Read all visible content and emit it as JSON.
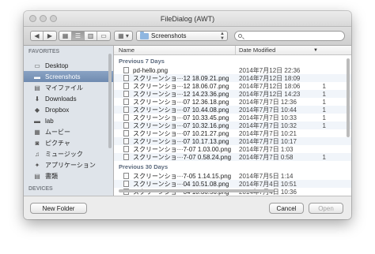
{
  "window": {
    "title": "FileDialog (AWT)"
  },
  "toolbar": {
    "back": "◀",
    "forward": "▶",
    "view_icon": "▦",
    "view_list": "☰",
    "view_columns": "▥",
    "view_coverflow": "▭",
    "arrange": "▦ ▾",
    "path_label": "Screenshots",
    "search_placeholder": ""
  },
  "sidebar": {
    "section_favorites": "FAVORITES",
    "section_devices": "DEVICES",
    "items": [
      {
        "label": "Desktop",
        "icon": "desktop-icon",
        "glyph": "▭"
      },
      {
        "label": "Screenshots",
        "icon": "folder-icon",
        "glyph": "▬"
      },
      {
        "label": "マイファイル",
        "icon": "all-my-files-icon",
        "glyph": "▤"
      },
      {
        "label": "Downloads",
        "icon": "downloads-icon",
        "glyph": "⬇"
      },
      {
        "label": "Dropbox",
        "icon": "dropbox-icon",
        "glyph": "◆"
      },
      {
        "label": "lab",
        "icon": "folder-icon",
        "glyph": "▬"
      },
      {
        "label": "ムービー",
        "icon": "movies-icon",
        "glyph": "▦"
      },
      {
        "label": "ピクチャ",
        "icon": "pictures-icon",
        "glyph": "◙"
      },
      {
        "label": "ミュージック",
        "icon": "music-icon",
        "glyph": "♫"
      },
      {
        "label": "アプリケーション",
        "icon": "applications-icon",
        "glyph": "✦"
      },
      {
        "label": "書類",
        "icon": "documents-icon",
        "glyph": "▤"
      }
    ]
  },
  "list": {
    "col_name": "Name",
    "col_date": "Date Modified",
    "sort_indicator": "▼",
    "groups": [
      {
        "label": "Previous 7 Days",
        "rows": [
          {
            "name": "pd-hello.png",
            "date": "2014年7月12日 22:36",
            "extra": ""
          },
          {
            "name": "スクリーンショ···12 18.09.21.png",
            "date": "2014年7月12日 18:09",
            "extra": ""
          },
          {
            "name": "スクリーンショ···12 18.06.07.png",
            "date": "2014年7月12日 18:06",
            "extra": "1"
          },
          {
            "name": "スクリーンショ···12 14.23.36.png",
            "date": "2014年7月12日 14:23",
            "extra": "1"
          },
          {
            "name": "スクリーンショ···07 12.36.18.png",
            "date": "2014年7月7日 12:36",
            "extra": "1"
          },
          {
            "name": "スクリーンショ···07 10.44.08.png",
            "date": "2014年7月7日 10:44",
            "extra": "1"
          },
          {
            "name": "スクリーンショ···07 10.33.45.png",
            "date": "2014年7月7日 10:33",
            "extra": "1"
          },
          {
            "name": "スクリーンショ···07 10.32.16.png",
            "date": "2014年7月7日 10:32",
            "extra": "1"
          },
          {
            "name": "スクリーンショ···07 10.21.27.png",
            "date": "2014年7月7日 10:21",
            "extra": ""
          },
          {
            "name": "スクリーンショ···07 10.17.13.png",
            "date": "2014年7月7日 10:17",
            "extra": ""
          },
          {
            "name": "スクリーンショ···7-07 1.03.00.png",
            "date": "2014年7月7日 1:03",
            "extra": ""
          },
          {
            "name": "スクリーンショ···7-07 0.58.24.png",
            "date": "2014年7月7日 0:58",
            "extra": "1"
          }
        ]
      },
      {
        "label": "Previous 30 Days",
        "rows": [
          {
            "name": "スクリーンショ···7-05 1.14.15.png",
            "date": "2014年7月5日 1:14",
            "extra": ""
          },
          {
            "name": "スクリーンショ···04 10.51.08.png",
            "date": "2014年7月4日 10:51",
            "extra": ""
          },
          {
            "name": "スクリーンショ···04 10.36.56.png",
            "date": "2014年7月4日 10:36",
            "extra": ""
          }
        ]
      }
    ]
  },
  "footer": {
    "new_folder": "New Folder",
    "cancel": "Cancel",
    "open": "Open"
  }
}
